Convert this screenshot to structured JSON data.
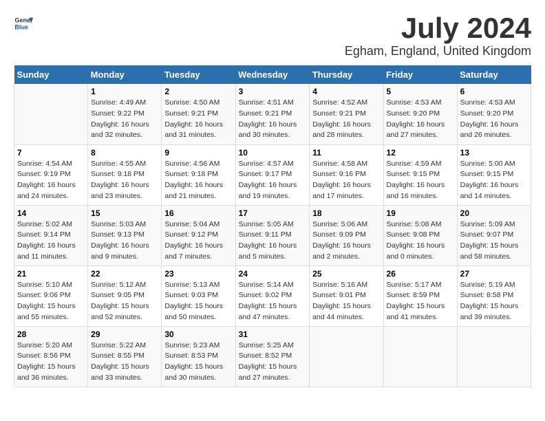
{
  "header": {
    "logo_line1": "General",
    "logo_line2": "Blue",
    "month": "July 2024",
    "location": "Egham, England, United Kingdom"
  },
  "days_of_week": [
    "Sunday",
    "Monday",
    "Tuesday",
    "Wednesday",
    "Thursday",
    "Friday",
    "Saturday"
  ],
  "weeks": [
    [
      {
        "day": "",
        "sunrise": "",
        "sunset": "",
        "daylight": ""
      },
      {
        "day": "1",
        "sunrise": "Sunrise: 4:49 AM",
        "sunset": "Sunset: 9:22 PM",
        "daylight": "Daylight: 16 hours and 32 minutes."
      },
      {
        "day": "2",
        "sunrise": "Sunrise: 4:50 AM",
        "sunset": "Sunset: 9:21 PM",
        "daylight": "Daylight: 16 hours and 31 minutes."
      },
      {
        "day": "3",
        "sunrise": "Sunrise: 4:51 AM",
        "sunset": "Sunset: 9:21 PM",
        "daylight": "Daylight: 16 hours and 30 minutes."
      },
      {
        "day": "4",
        "sunrise": "Sunrise: 4:52 AM",
        "sunset": "Sunset: 9:21 PM",
        "daylight": "Daylight: 16 hours and 28 minutes."
      },
      {
        "day": "5",
        "sunrise": "Sunrise: 4:53 AM",
        "sunset": "Sunset: 9:20 PM",
        "daylight": "Daylight: 16 hours and 27 minutes."
      },
      {
        "day": "6",
        "sunrise": "Sunrise: 4:53 AM",
        "sunset": "Sunset: 9:20 PM",
        "daylight": "Daylight: 16 hours and 26 minutes."
      }
    ],
    [
      {
        "day": "7",
        "sunrise": "Sunrise: 4:54 AM",
        "sunset": "Sunset: 9:19 PM",
        "daylight": "Daylight: 16 hours and 24 minutes."
      },
      {
        "day": "8",
        "sunrise": "Sunrise: 4:55 AM",
        "sunset": "Sunset: 9:18 PM",
        "daylight": "Daylight: 16 hours and 23 minutes."
      },
      {
        "day": "9",
        "sunrise": "Sunrise: 4:56 AM",
        "sunset": "Sunset: 9:18 PM",
        "daylight": "Daylight: 16 hours and 21 minutes."
      },
      {
        "day": "10",
        "sunrise": "Sunrise: 4:57 AM",
        "sunset": "Sunset: 9:17 PM",
        "daylight": "Daylight: 16 hours and 19 minutes."
      },
      {
        "day": "11",
        "sunrise": "Sunrise: 4:58 AM",
        "sunset": "Sunset: 9:16 PM",
        "daylight": "Daylight: 16 hours and 17 minutes."
      },
      {
        "day": "12",
        "sunrise": "Sunrise: 4:59 AM",
        "sunset": "Sunset: 9:15 PM",
        "daylight": "Daylight: 16 hours and 16 minutes."
      },
      {
        "day": "13",
        "sunrise": "Sunrise: 5:00 AM",
        "sunset": "Sunset: 9:15 PM",
        "daylight": "Daylight: 16 hours and 14 minutes."
      }
    ],
    [
      {
        "day": "14",
        "sunrise": "Sunrise: 5:02 AM",
        "sunset": "Sunset: 9:14 PM",
        "daylight": "Daylight: 16 hours and 11 minutes."
      },
      {
        "day": "15",
        "sunrise": "Sunrise: 5:03 AM",
        "sunset": "Sunset: 9:13 PM",
        "daylight": "Daylight: 16 hours and 9 minutes."
      },
      {
        "day": "16",
        "sunrise": "Sunrise: 5:04 AM",
        "sunset": "Sunset: 9:12 PM",
        "daylight": "Daylight: 16 hours and 7 minutes."
      },
      {
        "day": "17",
        "sunrise": "Sunrise: 5:05 AM",
        "sunset": "Sunset: 9:11 PM",
        "daylight": "Daylight: 16 hours and 5 minutes."
      },
      {
        "day": "18",
        "sunrise": "Sunrise: 5:06 AM",
        "sunset": "Sunset: 9:09 PM",
        "daylight": "Daylight: 16 hours and 2 minutes."
      },
      {
        "day": "19",
        "sunrise": "Sunrise: 5:08 AM",
        "sunset": "Sunset: 9:08 PM",
        "daylight": "Daylight: 16 hours and 0 minutes."
      },
      {
        "day": "20",
        "sunrise": "Sunrise: 5:09 AM",
        "sunset": "Sunset: 9:07 PM",
        "daylight": "Daylight: 15 hours and 58 minutes."
      }
    ],
    [
      {
        "day": "21",
        "sunrise": "Sunrise: 5:10 AM",
        "sunset": "Sunset: 9:06 PM",
        "daylight": "Daylight: 15 hours and 55 minutes."
      },
      {
        "day": "22",
        "sunrise": "Sunrise: 5:12 AM",
        "sunset": "Sunset: 9:05 PM",
        "daylight": "Daylight: 15 hours and 52 minutes."
      },
      {
        "day": "23",
        "sunrise": "Sunrise: 5:13 AM",
        "sunset": "Sunset: 9:03 PM",
        "daylight": "Daylight: 15 hours and 50 minutes."
      },
      {
        "day": "24",
        "sunrise": "Sunrise: 5:14 AM",
        "sunset": "Sunset: 9:02 PM",
        "daylight": "Daylight: 15 hours and 47 minutes."
      },
      {
        "day": "25",
        "sunrise": "Sunrise: 5:16 AM",
        "sunset": "Sunset: 9:01 PM",
        "daylight": "Daylight: 15 hours and 44 minutes."
      },
      {
        "day": "26",
        "sunrise": "Sunrise: 5:17 AM",
        "sunset": "Sunset: 8:59 PM",
        "daylight": "Daylight: 15 hours and 41 minutes."
      },
      {
        "day": "27",
        "sunrise": "Sunrise: 5:19 AM",
        "sunset": "Sunset: 8:58 PM",
        "daylight": "Daylight: 15 hours and 39 minutes."
      }
    ],
    [
      {
        "day": "28",
        "sunrise": "Sunrise: 5:20 AM",
        "sunset": "Sunset: 8:56 PM",
        "daylight": "Daylight: 15 hours and 36 minutes."
      },
      {
        "day": "29",
        "sunrise": "Sunrise: 5:22 AM",
        "sunset": "Sunset: 8:55 PM",
        "daylight": "Daylight: 15 hours and 33 minutes."
      },
      {
        "day": "30",
        "sunrise": "Sunrise: 5:23 AM",
        "sunset": "Sunset: 8:53 PM",
        "daylight": "Daylight: 15 hours and 30 minutes."
      },
      {
        "day": "31",
        "sunrise": "Sunrise: 5:25 AM",
        "sunset": "Sunset: 8:52 PM",
        "daylight": "Daylight: 15 hours and 27 minutes."
      },
      {
        "day": "",
        "sunrise": "",
        "sunset": "",
        "daylight": ""
      },
      {
        "day": "",
        "sunrise": "",
        "sunset": "",
        "daylight": ""
      },
      {
        "day": "",
        "sunrise": "",
        "sunset": "",
        "daylight": ""
      }
    ]
  ]
}
